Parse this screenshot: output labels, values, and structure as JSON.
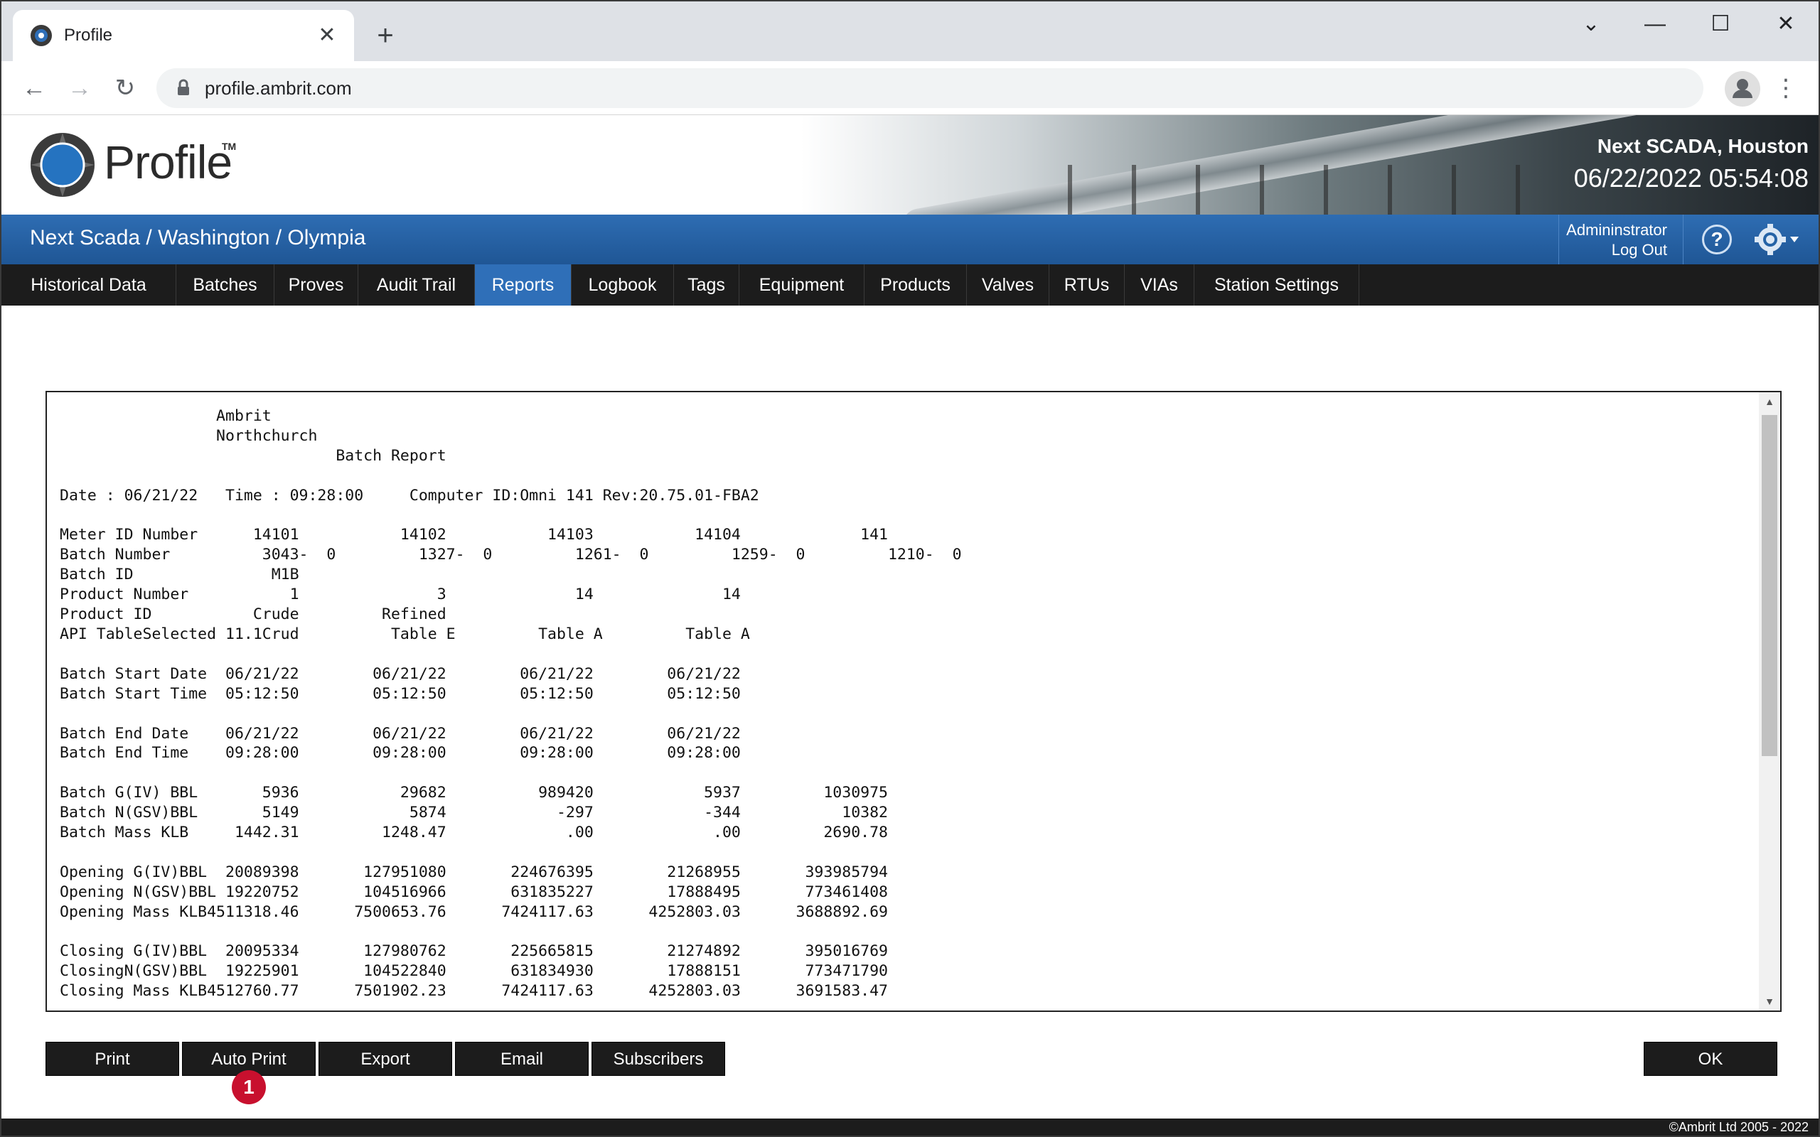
{
  "browser": {
    "tab_title": "Profile",
    "url": "profile.ambrit.com",
    "new_tab_symbol": "+",
    "close_symbol": "✕",
    "minimize_symbol": "—",
    "maximize_symbol": "☐",
    "window_close_symbol": "✕",
    "tab_search_symbol": "⌄"
  },
  "header": {
    "logo_text": "Profile",
    "trademark": "TM",
    "site_name": "Next SCADA, Houston",
    "clock": "06/22/2022 05:54:08"
  },
  "bluebar": {
    "breadcrumb": "Next Scada / Washington / Olympia",
    "user": "Admininstrator",
    "logout": "Log Out",
    "help": "?"
  },
  "nav": {
    "items": [
      {
        "label": "Historical Data"
      },
      {
        "label": "Batches"
      },
      {
        "label": "Proves"
      },
      {
        "label": "Audit Trail"
      },
      {
        "label": "Reports"
      },
      {
        "label": "Logbook"
      },
      {
        "label": "Tags"
      },
      {
        "label": "Equipment"
      },
      {
        "label": "Products"
      },
      {
        "label": "Valves"
      },
      {
        "label": "RTUs"
      },
      {
        "label": "VIAs"
      },
      {
        "label": "Station Settings"
      }
    ],
    "active": "Reports"
  },
  "report": {
    "lines": [
      "                 Ambrit",
      "                 Northchurch",
      "                              Batch Report",
      "",
      "Date : 06/21/22   Time : 09:28:00     Computer ID:Omni 141 Rev:20.75.01-FBA2",
      "",
      "Meter ID Number      14101           14102           14103           14104             141",
      "Batch Number          3043-  0         1327-  0         1261-  0         1259-  0         1210-  0",
      "Batch ID               M1B",
      "Product Number           1               3              14              14",
      "Product ID           Crude         Refined",
      "API TableSelected 11.1Crud          Table E         Table A         Table A",
      "",
      "Batch Start Date  06/21/22        06/21/22        06/21/22        06/21/22",
      "Batch Start Time  05:12:50        05:12:50        05:12:50        05:12:50",
      "",
      "Batch End Date    06/21/22        06/21/22        06/21/22        06/21/22",
      "Batch End Time    09:28:00        09:28:00        09:28:00        09:28:00",
      "",
      "Batch G(IV) BBL       5936           29682          989420            5937         1030975",
      "Batch N(GSV)BBL       5149            5874            -297            -344           10382",
      "Batch Mass KLB     1442.31         1248.47             .00             .00         2690.78",
      "",
      "Opening G(IV)BBL  20089398       127951080       224676395        21268955       393985794",
      "Opening N(GSV)BBL 19220752       104516966       631835227        17888495       773461408",
      "Opening Mass KLB4511318.46      7500653.76      7424117.63      4252803.03      3688892.69",
      "",
      "Closing G(IV)BBL  20095334       127980762       225665815        21274892       395016769",
      "ClosingN(GSV)BBL  19225901       104522840       631834930        17888151       773471790",
      "Closing Mass KLB4512760.77      7501902.23      7424117.63      4252803.03      3691583.47"
    ]
  },
  "actions": {
    "print": "Print",
    "auto_print": "Auto Print",
    "export": "Export",
    "email": "Email",
    "subscribers": "Subscribers",
    "ok": "OK",
    "badge": "1"
  },
  "footer": {
    "copyright": "©Ambrit Ltd 2005 - 2022"
  },
  "colors": {
    "accent_blue": "#2f6fb8",
    "nav_bg": "#1c1c1c",
    "badge_red": "#c8102e"
  }
}
